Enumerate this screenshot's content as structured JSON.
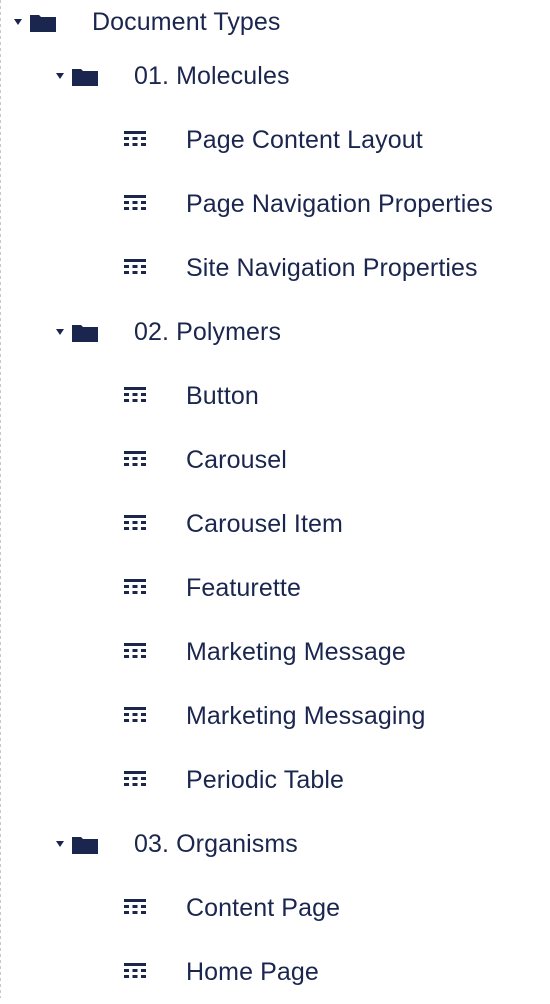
{
  "tree": {
    "root": {
      "label": "Document Types",
      "icon": "folder-icon",
      "expanded": true,
      "children": [
        {
          "label": "01. Molecules",
          "icon": "folder-icon",
          "expanded": true,
          "items": [
            {
              "label": "Page Content Layout",
              "icon": "document-type-icon"
            },
            {
              "label": "Page Navigation Properties",
              "icon": "document-type-icon"
            },
            {
              "label": "Site Navigation Properties",
              "icon": "document-type-icon"
            }
          ]
        },
        {
          "label": "02. Polymers",
          "icon": "folder-icon",
          "expanded": true,
          "items": [
            {
              "label": "Button",
              "icon": "document-type-icon"
            },
            {
              "label": "Carousel",
              "icon": "document-type-icon"
            },
            {
              "label": "Carousel Item",
              "icon": "document-type-icon"
            },
            {
              "label": "Featurette",
              "icon": "document-type-icon"
            },
            {
              "label": "Marketing Message",
              "icon": "document-type-icon"
            },
            {
              "label": "Marketing Messaging",
              "icon": "document-type-icon"
            },
            {
              "label": "Periodic Table",
              "icon": "document-type-icon"
            }
          ]
        },
        {
          "label": "03. Organisms",
          "icon": "folder-icon",
          "expanded": true,
          "items": [
            {
              "label": "Content Page",
              "icon": "document-type-icon"
            },
            {
              "label": "Home Page",
              "icon": "document-type-icon"
            }
          ]
        }
      ]
    }
  },
  "colors": {
    "text": "#1b264f",
    "icon": "#1b264f",
    "background": "#ffffff"
  }
}
